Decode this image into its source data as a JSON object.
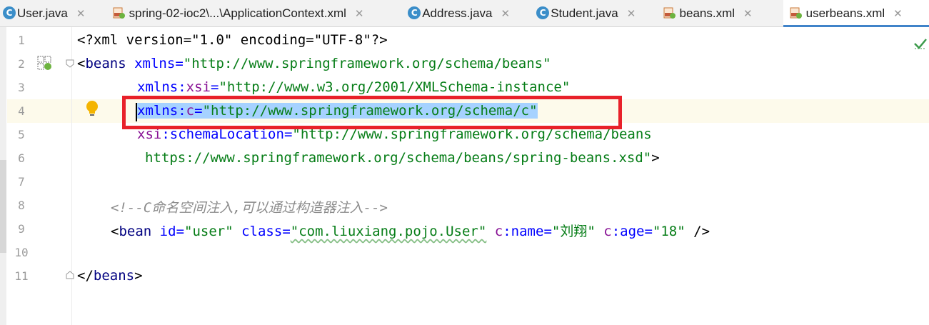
{
  "tabs": [
    {
      "label": "User.java",
      "icon": "java-class-icon",
      "active": false
    },
    {
      "label": "spring-02-ioc2\\...\\ApplicationContext.xml",
      "icon": "spring-xml-icon",
      "active": false
    },
    {
      "label": "Address.java",
      "icon": "java-class-icon",
      "active": false
    },
    {
      "label": "Student.java",
      "icon": "java-class-icon",
      "active": false
    },
    {
      "label": "beans.xml",
      "icon": "spring-xml-icon",
      "active": false
    },
    {
      "label": "userbeans.xml",
      "icon": "spring-xml-icon",
      "active": true
    }
  ],
  "tab_close_glyph": "✕",
  "java_icon_letter": "C",
  "editor": {
    "line_numbers": [
      "1",
      "2",
      "3",
      "4",
      "5",
      "6",
      "7",
      "8",
      "9",
      "10",
      "11"
    ],
    "line1": {
      "pi": "<?xml version=\"1.0\" encoding=\"UTF-8\"?>"
    },
    "line2": {
      "open": "<",
      "tag": "beans",
      "attr": "xmlns",
      "eq": "=",
      "val": "\"http://www.springframework.org/schema/beans\""
    },
    "line3": {
      "attr": "xmlns",
      "colon": ":",
      "ns": "xsi",
      "eq": "=",
      "val": "\"http://www.w3.org/2001/XMLSchema-instance\""
    },
    "line4": {
      "attr": "xmlns",
      "colon": ":",
      "ns": "c",
      "eq": "=",
      "val": "\"http://www.springframework.org/schema/c\""
    },
    "line5": {
      "ns": "xsi",
      "colon": ":",
      "attr": "schemaLocation",
      "eq": "=",
      "val": "\"http://www.springframework.org/schema/beans"
    },
    "line6": {
      "val": "https://www.springframework.org/schema/beans/spring-beans.xsd\"",
      "close": ">"
    },
    "line8": {
      "comment": "<!--C命名空间注入,可以通过构造器注入-->"
    },
    "line9": {
      "open": "<",
      "tag": "bean",
      "a1": "id",
      "v1": "\"user\"",
      "a2": "class",
      "v2": "\"com.liuxiang.pojo.User\"",
      "a3ns": "c",
      "a3": "name",
      "v3": "\"刘翔\"",
      "a4ns": "c",
      "a4": "age",
      "v4": "\"18\"",
      "close": "/>"
    },
    "line11": {
      "open": "</",
      "tag": "beans",
      "close": ">"
    }
  },
  "colors": {
    "highlight_box": "#e8212a",
    "selection": "#a6d2ff",
    "active_tab_underline": "#4083c9",
    "tag": "#000080",
    "attribute": "#0000ff",
    "namespace": "#871094",
    "value": "#067d17",
    "comment": "#8c8c8c"
  },
  "icons": [
    "java-class-icon",
    "spring-xml-icon",
    "close-icon",
    "spring-bean-gutter-icon",
    "fold-icon",
    "intention-bulb-icon",
    "inspection-ok-icon"
  ]
}
